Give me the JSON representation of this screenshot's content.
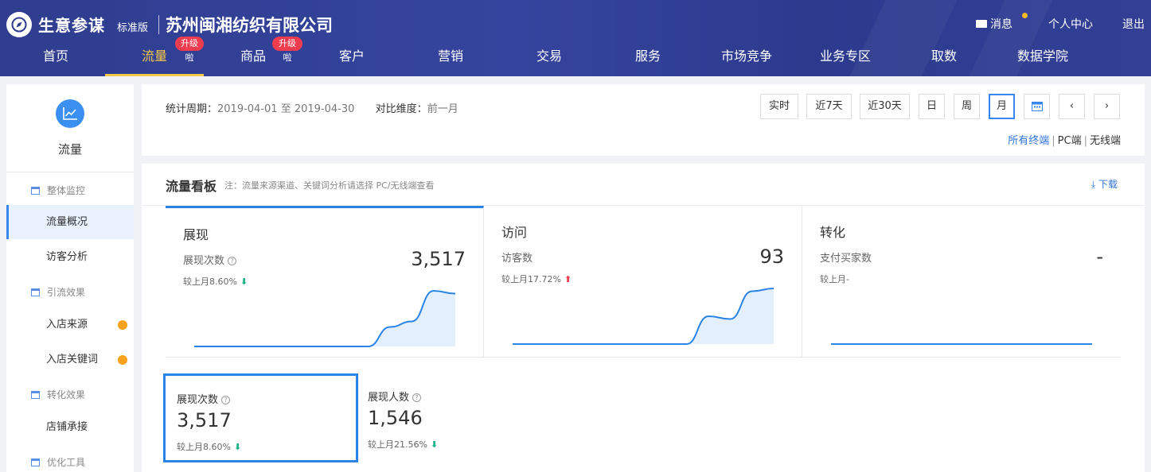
{
  "header": {
    "brand": "生意参谋",
    "edition": "标准版",
    "company": "苏州闽湘纺织有限公司",
    "messages_label": "消息",
    "personal_center": "个人中心",
    "logout": "退出"
  },
  "nav": {
    "items": [
      {
        "label": "首页"
      },
      {
        "label": "流量",
        "badge": "升级啦",
        "active": true
      },
      {
        "label": "商品",
        "badge": "升级啦"
      },
      {
        "label": "客户"
      },
      {
        "label": "营销"
      },
      {
        "label": "交易"
      },
      {
        "label": "服务"
      },
      {
        "label": "市场竞争"
      },
      {
        "label": "业务专区"
      },
      {
        "label": "取数"
      },
      {
        "label": "数据学院"
      }
    ]
  },
  "sidebar": {
    "title": "流量",
    "groups": [
      {
        "label": "整体监控",
        "items": [
          "流量概况",
          "访客分析"
        ]
      },
      {
        "label": "引流效果",
        "items": [
          "入店来源",
          "入店关键词"
        ]
      },
      {
        "label": "转化效果",
        "items": [
          "店铺承接"
        ]
      },
      {
        "label": "优化工具",
        "items": []
      }
    ]
  },
  "period": {
    "label": "统计周期：",
    "range": "2019-04-01 至 2019-04-30",
    "compare_label": "对比维度：",
    "compare_value": "前一月",
    "buttons": [
      "实时",
      "近7天",
      "近30天",
      "日",
      "周",
      "月"
    ],
    "selected": "月",
    "terminals": [
      "所有终端",
      "PC端",
      "无线端"
    ]
  },
  "board": {
    "title": "流量看板",
    "note": "注：流量来源渠道、关键词分析请选择 PC/无线端查看",
    "download": "下载",
    "kpis": [
      {
        "title": "展现",
        "metric": "展现次数",
        "value": "3,517",
        "compare": "较上月8.60%",
        "trend": "down",
        "sparkline": [
          0,
          0,
          0,
          0,
          0,
          0,
          0,
          0,
          0,
          0.35,
          0.45,
          1.0,
          0.95
        ]
      },
      {
        "title": "访问",
        "metric": "访客数",
        "value": "93",
        "compare": "较上月17.72%",
        "trend": "up",
        "sparkline": [
          0,
          0,
          0,
          0,
          0,
          0,
          0,
          0,
          0,
          0.5,
          0.45,
          0.95,
          1.0
        ]
      },
      {
        "title": "转化",
        "metric": "支付买家数",
        "value": "-",
        "compare": "较上月-",
        "trend": "none",
        "sparkline": [
          0,
          0,
          0,
          0,
          0,
          0,
          0,
          0,
          0,
          0,
          0,
          0,
          0
        ]
      }
    ],
    "metrics": [
      {
        "title": "展现次数",
        "value": "3,517",
        "compare": "较上月8.60%",
        "trend": "down"
      },
      {
        "title": "展现人数",
        "value": "1,546",
        "compare": "较上月21.56%",
        "trend": "down"
      }
    ]
  },
  "colors": {
    "header": "#2f3d8f",
    "accent": "#2a84e5",
    "nav_active": "#f7c948",
    "badge": "#ef3c4f",
    "down": "#1ab58a",
    "up": "#ef3c4f"
  }
}
